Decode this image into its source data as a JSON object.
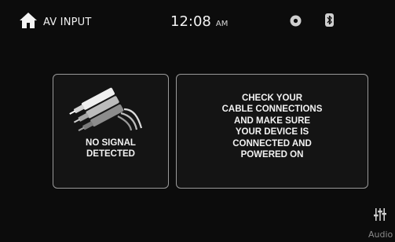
{
  "status_bar": {
    "source_title": "AV INPUT",
    "time": "12:08",
    "ampm": "AM",
    "icons": [
      "home-icon",
      "disc-icon",
      "bluetooth-icon"
    ]
  },
  "no_signal_panel": {
    "icon": "av-cable-icon",
    "text": "NO SIGNAL\nDETECTED"
  },
  "message_panel": {
    "text": "CHECK YOUR\nCABLE CONNECTIONS\nAND MAKE SURE\nYOUR DEVICE IS\nCONNECTED AND\nPOWERED ON"
  },
  "audio_control": {
    "icon": "equalizer-icon",
    "label": "Audio"
  },
  "colors": {
    "background": "#0c0c0c",
    "panel_border": "#9a9a9a",
    "text": "#f2f2f2",
    "muted_text": "#8a8a8a"
  }
}
